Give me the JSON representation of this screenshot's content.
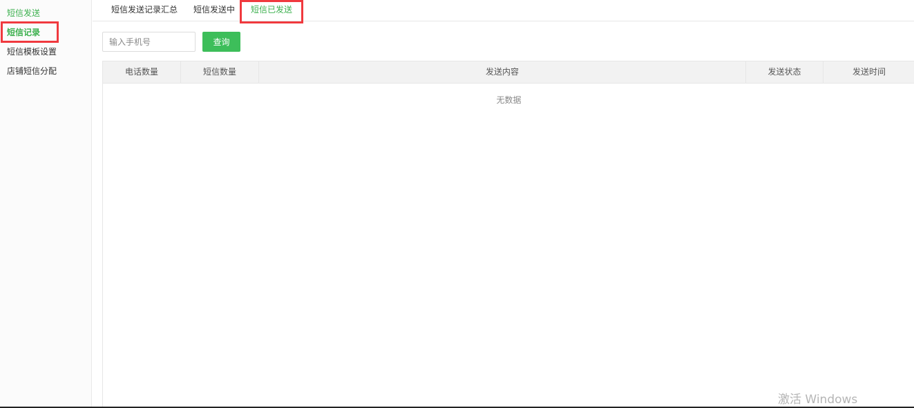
{
  "sidebar": {
    "items": [
      {
        "label": "短信发送"
      },
      {
        "label": "短信记录"
      },
      {
        "label": "短信模板设置"
      },
      {
        "label": "店铺短信分配"
      }
    ]
  },
  "tabs": [
    {
      "label": "短信发送记录汇总"
    },
    {
      "label": "短信发送中"
    },
    {
      "label": "短信已发送"
    }
  ],
  "search": {
    "placeholder": "输入手机号",
    "value": "",
    "button_label": "查询"
  },
  "table": {
    "columns": [
      "电话数量",
      "短信数量",
      "发送内容",
      "发送状态",
      "发送时间"
    ],
    "rows": [],
    "empty_text": "无数据"
  },
  "watermark": {
    "text": "激活 Windows"
  },
  "colors": {
    "accent": "#3cb04e",
    "button": "#3dbe5a",
    "highlight": "#f0393e"
  }
}
